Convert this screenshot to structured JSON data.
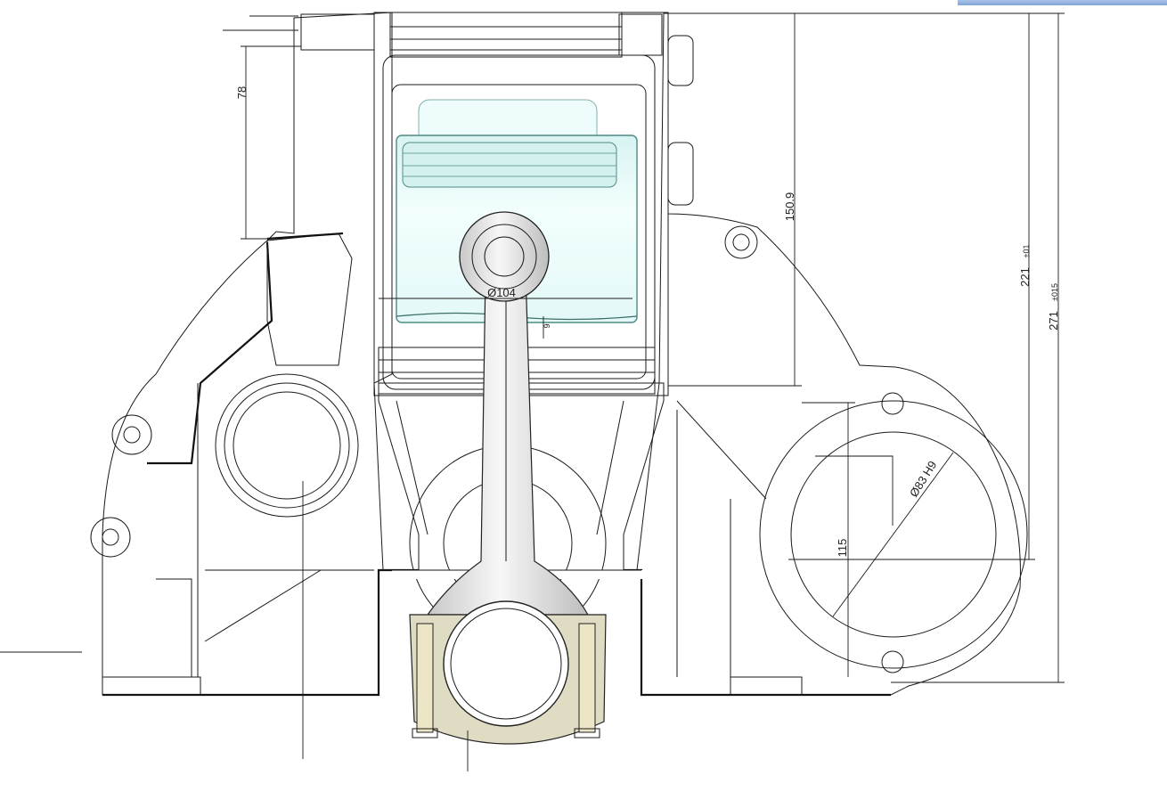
{
  "dimensions": {
    "d78": "78",
    "d150_9": "150.9",
    "d221": "221",
    "d221_tol": "±01",
    "d271": "271",
    "d271_tol": "±015",
    "phi104": "Ø104",
    "d9": "9",
    "d115": "115",
    "phi83": "Ø83 H9"
  },
  "colors": {
    "casting": "#b3b3b3",
    "casting_dark": "#8e8e8e",
    "casting_light": "#d6d6d6",
    "piston": "#e6fbfa",
    "piston_edge": "#9fc9c6",
    "rod": "#e9e9e9",
    "bolts": "#e8e2c4",
    "accent_bar": "#8aaede"
  }
}
